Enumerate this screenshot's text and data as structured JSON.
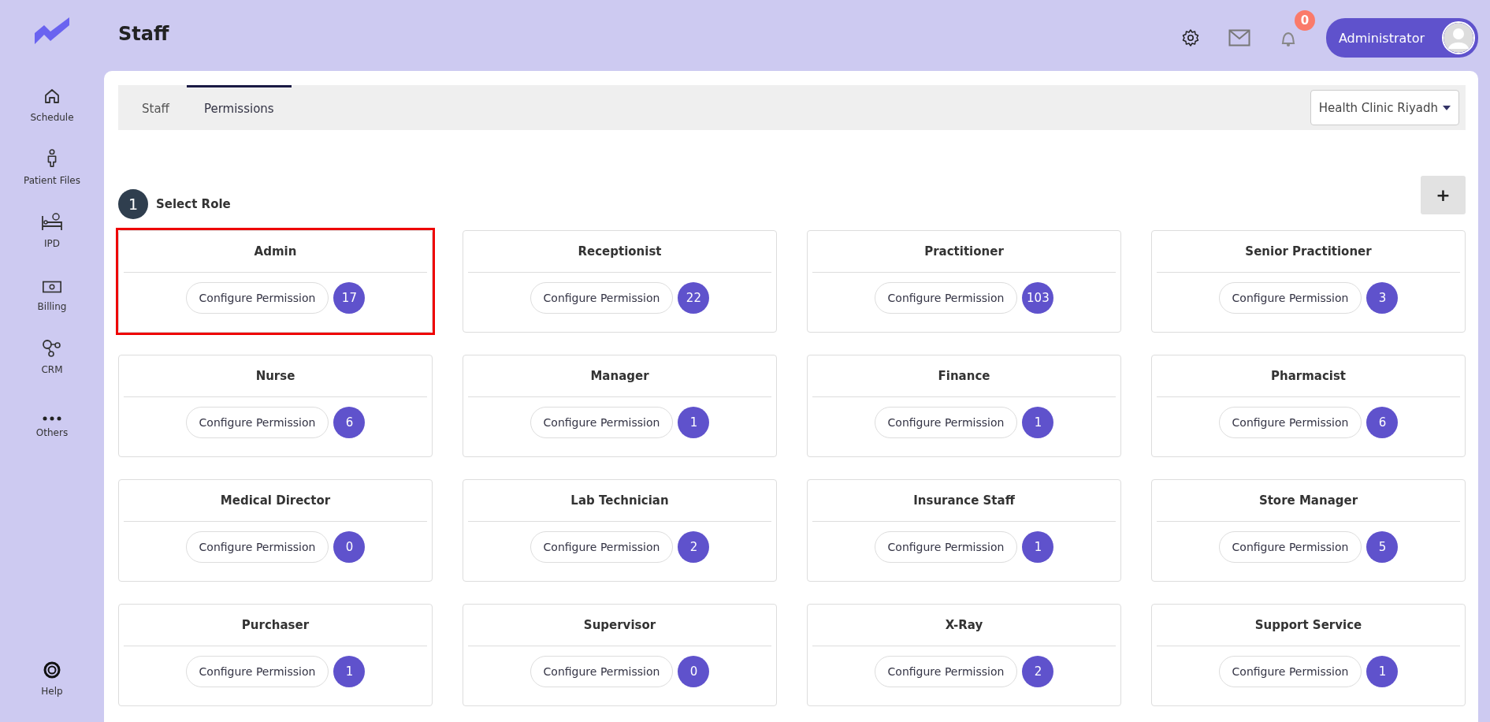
{
  "sidebar": {
    "items": [
      {
        "label": "Schedule",
        "kind": "home"
      },
      {
        "label": "Patient Files",
        "kind": "person"
      },
      {
        "label": "IPD",
        "kind": "bed"
      },
      {
        "label": "Billing",
        "kind": "money"
      },
      {
        "label": "CRM",
        "kind": "crm"
      },
      {
        "label": "Others",
        "kind": "dots"
      }
    ],
    "help": "Help"
  },
  "header": {
    "title": "Staff",
    "notification_count": "0",
    "user": "Administrator"
  },
  "tabs": [
    {
      "label": "Staff",
      "selected": false
    },
    {
      "label": "Permissions",
      "selected": true
    }
  ],
  "clinic_select": {
    "value": "Health Clinic Riyadh"
  },
  "step": {
    "number": "1",
    "label": "Select Role"
  },
  "add_button": "+",
  "roles": [
    {
      "name": "Admin",
      "button": "Configure Permission",
      "count": "17",
      "selected": true
    },
    {
      "name": "Receptionist",
      "button": "Configure Permission",
      "count": "22",
      "selected": false
    },
    {
      "name": "Practitioner",
      "button": "Configure Permission",
      "count": "103",
      "selected": false
    },
    {
      "name": "Senior Practitioner",
      "button": "Configure Permission",
      "count": "3",
      "selected": false
    },
    {
      "name": "Nurse",
      "button": "Configure Permission",
      "count": "6",
      "selected": false
    },
    {
      "name": "Manager",
      "button": "Configure Permission",
      "count": "1",
      "selected": false
    },
    {
      "name": "Finance",
      "button": "Configure Permission",
      "count": "1",
      "selected": false
    },
    {
      "name": "Pharmacist",
      "button": "Configure Permission",
      "count": "6",
      "selected": false
    },
    {
      "name": "Medical Director",
      "button": "Configure Permission",
      "count": "0",
      "selected": false
    },
    {
      "name": "Lab Technician",
      "button": "Configure Permission",
      "count": "2",
      "selected": false
    },
    {
      "name": "Insurance Staff",
      "button": "Configure Permission",
      "count": "1",
      "selected": false
    },
    {
      "name": "Store Manager",
      "button": "Configure Permission",
      "count": "5",
      "selected": false
    },
    {
      "name": "Purchaser",
      "button": "Configure Permission",
      "count": "1",
      "selected": false
    },
    {
      "name": "Supervisor",
      "button": "Configure Permission",
      "count": "0",
      "selected": false
    },
    {
      "name": "X-Ray",
      "button": "Configure Permission",
      "count": "2",
      "selected": false
    },
    {
      "name": "Support Service",
      "button": "Configure Permission",
      "count": "1",
      "selected": false
    }
  ]
}
